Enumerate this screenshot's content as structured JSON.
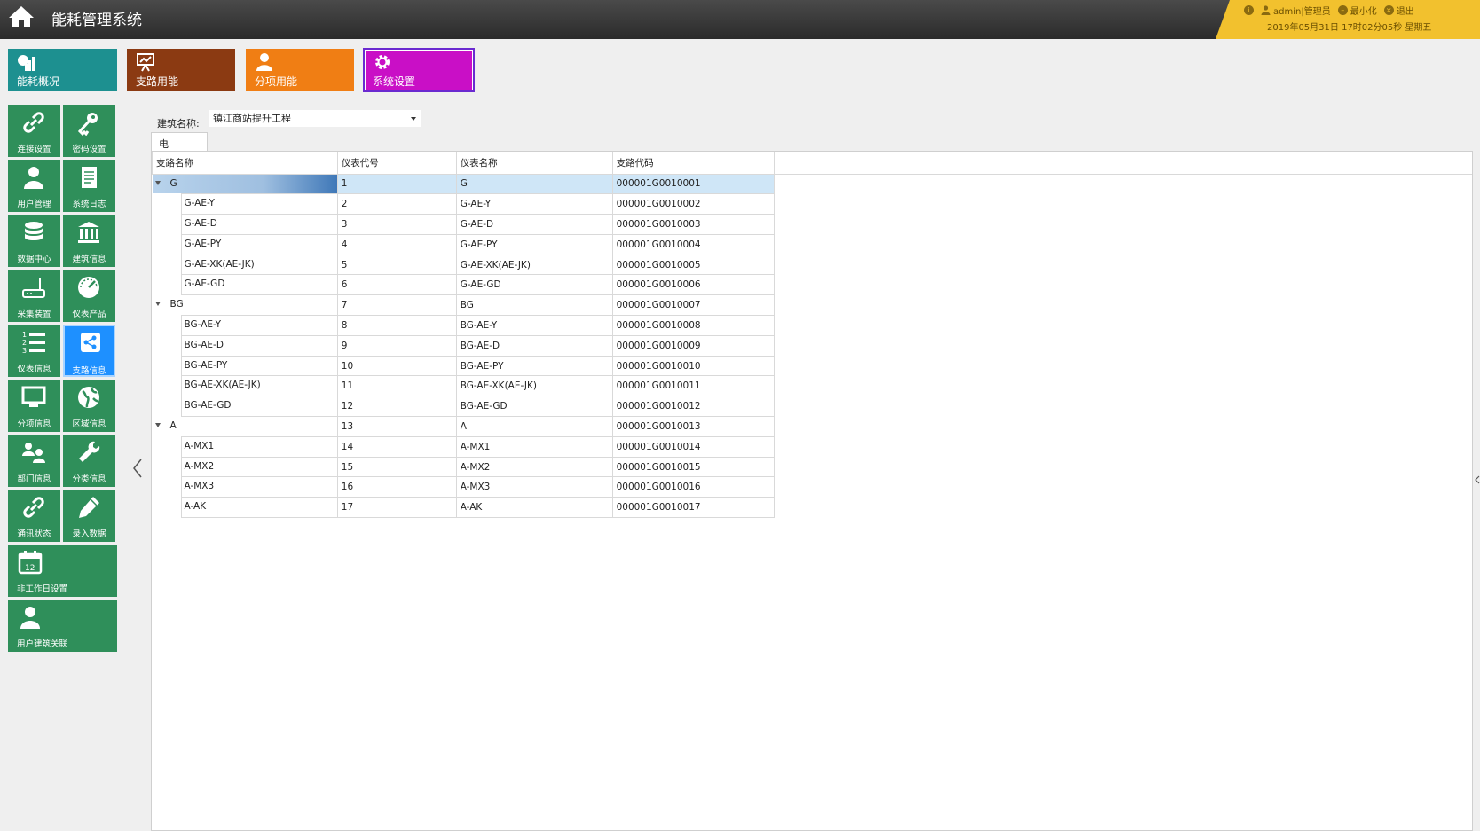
{
  "app": {
    "title": "能耗管理系统",
    "icon": "home-icon"
  },
  "userbar": {
    "info_icon": "info-icon",
    "user_icon": "user-icon",
    "user_label": "admin|管理员",
    "minimize_icon": "minimize-icon",
    "minimize_label": "最小化",
    "exit_icon": "exit-icon",
    "exit_label": "退出",
    "datetime": "2019年05月31日 17时02分05秒 星期五"
  },
  "topnav": [
    {
      "label": "能耗概况",
      "icon": "chart-icon",
      "color": "#1d9090"
    },
    {
      "label": "支路用能",
      "icon": "presentation-icon",
      "color": "#8b3a12"
    },
    {
      "label": "分项用能",
      "icon": "person-icon",
      "color": "#f07e14"
    },
    {
      "label": "系统设置",
      "icon": "gear-icon",
      "color": "#c90fc6",
      "active": true
    }
  ],
  "sidebar": [
    {
      "label": "连接设置",
      "icon": "link-icon"
    },
    {
      "label": "密码设置",
      "icon": "key-icon"
    },
    {
      "label": "用户管理",
      "icon": "user-icon"
    },
    {
      "label": "系统日志",
      "icon": "document-icon"
    },
    {
      "label": "数据中心",
      "icon": "database-icon"
    },
    {
      "label": "建筑信息",
      "icon": "building-icon"
    },
    {
      "label": "采集装置",
      "icon": "router-icon"
    },
    {
      "label": "仪表产品",
      "icon": "gauge-icon"
    },
    {
      "label": "仪表信息",
      "icon": "numbered-list-icon"
    },
    {
      "label": "支路信息",
      "icon": "share-icon",
      "active": true
    },
    {
      "label": "分项信息",
      "icon": "monitor-icon"
    },
    {
      "label": "区域信息",
      "icon": "globe-icon"
    },
    {
      "label": "部门信息",
      "icon": "group-icon"
    },
    {
      "label": "分类信息",
      "icon": "wrench-icon"
    },
    {
      "label": "通讯状态",
      "icon": "link-icon"
    },
    {
      "label": "录入数据",
      "icon": "pencil-icon"
    },
    {
      "label": "非工作日设置",
      "icon": "calendar-icon"
    },
    {
      "label": "用户建筑关联",
      "icon": "user-icon"
    }
  ],
  "filter": {
    "label": "建筑名称:",
    "value": "镇江商站提升工程"
  },
  "tabs": [
    {
      "label": "电"
    }
  ],
  "grid": {
    "columns": [
      "支路名称",
      "仪表代号",
      "仪表名称",
      "支路代码"
    ],
    "rows": [
      {
        "level": 0,
        "name": "G",
        "meter_no": "1",
        "meter_name": "G",
        "code": "000001G0010001",
        "selected": true
      },
      {
        "level": 1,
        "name": "G-AE-Y",
        "meter_no": "2",
        "meter_name": "G-AE-Y",
        "code": "000001G0010002"
      },
      {
        "level": 1,
        "name": "G-AE-D",
        "meter_no": "3",
        "meter_name": "G-AE-D",
        "code": "000001G0010003"
      },
      {
        "level": 1,
        "name": "G-AE-PY",
        "meter_no": "4",
        "meter_name": "G-AE-PY",
        "code": "000001G0010004"
      },
      {
        "level": 1,
        "name": "G-AE-XK(AE-JK)",
        "meter_no": "5",
        "meter_name": "G-AE-XK(AE-JK)",
        "code": "000001G0010005"
      },
      {
        "level": 1,
        "name": "G-AE-GD",
        "meter_no": "6",
        "meter_name": "G-AE-GD",
        "code": "000001G0010006"
      },
      {
        "level": 0,
        "name": "BG",
        "meter_no": "7",
        "meter_name": "BG",
        "code": "000001G0010007"
      },
      {
        "level": 1,
        "name": "BG-AE-Y",
        "meter_no": "8",
        "meter_name": "BG-AE-Y",
        "code": "000001G0010008"
      },
      {
        "level": 1,
        "name": "BG-AE-D",
        "meter_no": "9",
        "meter_name": "BG-AE-D",
        "code": "000001G0010009"
      },
      {
        "level": 1,
        "name": "BG-AE-PY",
        "meter_no": "10",
        "meter_name": "BG-AE-PY",
        "code": "000001G0010010"
      },
      {
        "level": 1,
        "name": "BG-AE-XK(AE-JK)",
        "meter_no": "11",
        "meter_name": "BG-AE-XK(AE-JK)",
        "code": "000001G0010011"
      },
      {
        "level": 1,
        "name": "BG-AE-GD",
        "meter_no": "12",
        "meter_name": "BG-AE-GD",
        "code": "000001G0010012"
      },
      {
        "level": 0,
        "name": "A",
        "meter_no": "13",
        "meter_name": "A",
        "code": "000001G0010013"
      },
      {
        "level": 1,
        "name": "A-MX1",
        "meter_no": "14",
        "meter_name": "A-MX1",
        "code": "000001G0010014"
      },
      {
        "level": 1,
        "name": "A-MX2",
        "meter_no": "15",
        "meter_name": "A-MX2",
        "code": "000001G0010015"
      },
      {
        "level": 1,
        "name": "A-MX3",
        "meter_no": "16",
        "meter_name": "A-MX3",
        "code": "000001G0010016"
      },
      {
        "level": 1,
        "name": "A-AK",
        "meter_no": "17",
        "meter_name": "A-AK",
        "code": "000001G0010017"
      }
    ]
  },
  "panel_toggle": {
    "left_icon": "chevron-left-icon",
    "right_icon": "chevron-left-icon"
  }
}
